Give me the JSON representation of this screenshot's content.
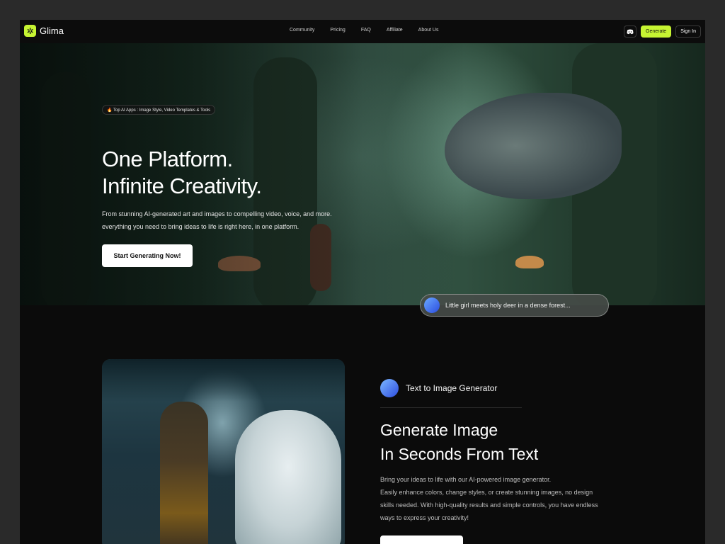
{
  "nav": {
    "brand": "Glima",
    "links": [
      "Community",
      "Pricing",
      "FAQ",
      "Affiliate",
      "About Us"
    ],
    "generate_label": "Generate",
    "signin_label": "Sign In",
    "icons": {
      "logo": "glima-logo-icon",
      "discord": "discord-icon"
    }
  },
  "hero": {
    "badge": "🔥 Top AI Apps : Image Style, Video Templates & Tools",
    "title_line1": "One Platform.",
    "title_line2": "Infinite Creativity.",
    "description_line1": "From stunning AI-generated art and images to compelling video, voice, and more.",
    "description_line2": "everything you need to bring ideas to life is right here, in one platform.",
    "cta_label": "Start Generating Now!",
    "prompt_text": "Little girl meets holy deer in a dense forest..."
  },
  "feature": {
    "label": "Text to Image Generator",
    "title_line1": "Generate Image",
    "title_line2": "In Seconds From Text",
    "desc_line1": "Bring your ideas to life with our AI-powered image generator.",
    "desc_line2": "Easily enhance colors, change styles, or create stunning images, no design",
    "desc_line3": "skills needed. With high-quality results and simple controls, you have endless",
    "desc_line4": "ways to express your creativity!"
  },
  "colors": {
    "accent": "#c6f432",
    "background": "#0b0b0b",
    "page": "#2a2a2a"
  }
}
